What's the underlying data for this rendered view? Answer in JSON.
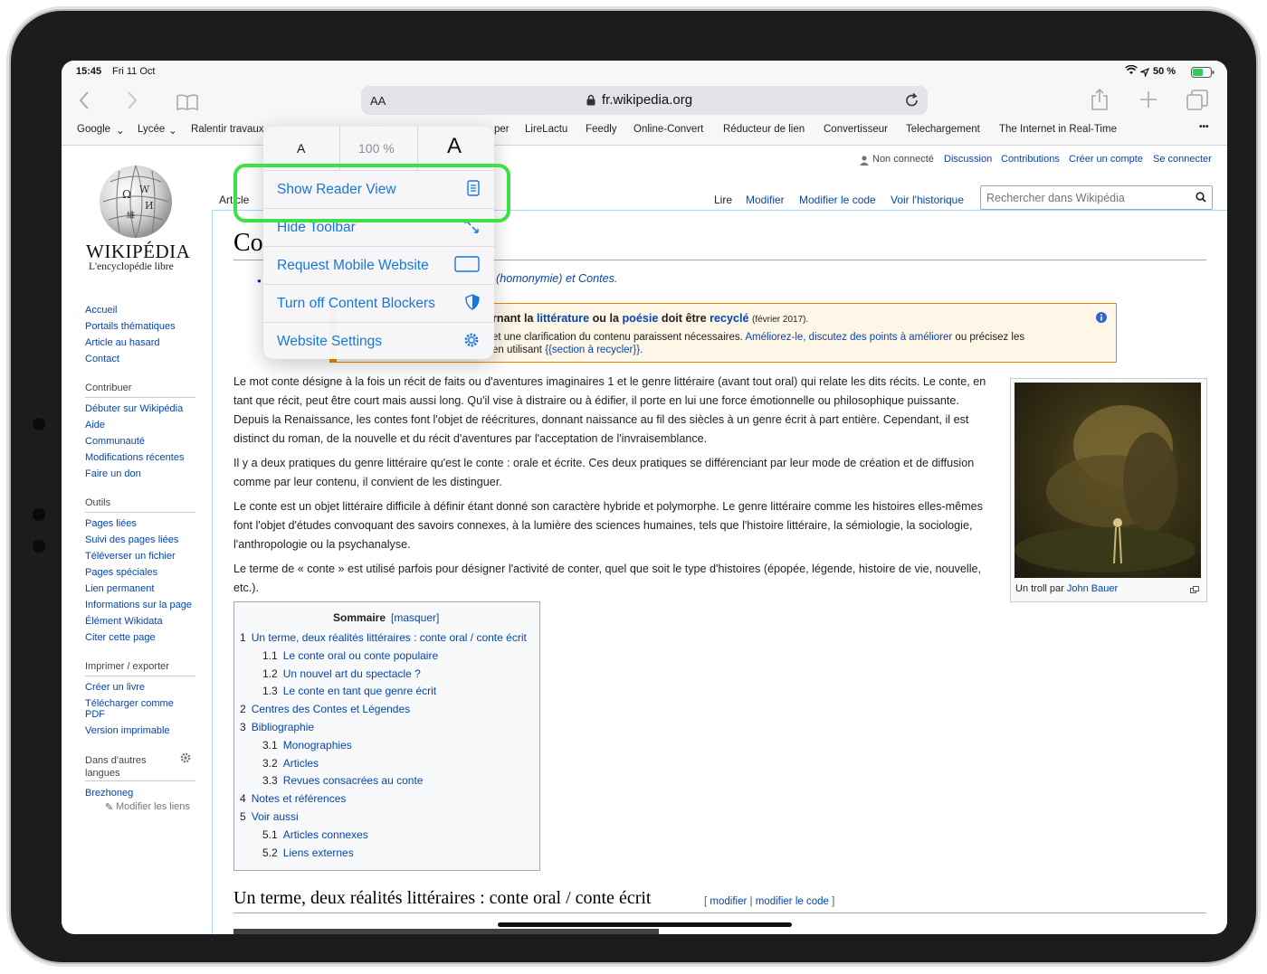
{
  "status": {
    "time": "15:45",
    "date": "Fri 11 Oct",
    "battery": "50 %"
  },
  "browser": {
    "url": "fr.wikipedia.org",
    "aa_label": "AA",
    "favorites": [
      "Google",
      "Lycée",
      "Ralentir travaux",
      "per",
      "LireLactu",
      "Feedly",
      "Online-Convert",
      "Réducteur de lien",
      "Convertisseur",
      "Telechargement",
      "The Internet in Real-Time"
    ],
    "more": "•••"
  },
  "menu": {
    "small_a": "A",
    "zoom": "100 %",
    "large_a": "A",
    "items": [
      "Show Reader View",
      "Hide Toolbar",
      "Request Mobile Website",
      "Turn off Content Blockers",
      "Website Settings"
    ]
  },
  "wiki": {
    "logo_title": "WIKIPÉDIA",
    "logo_subtitle": "L'encyclopédie libre",
    "user_links": [
      "Non connecté",
      "Discussion",
      "Contributions",
      "Créer un compte",
      "Se connecter"
    ],
    "tab_article": "Article",
    "view_tabs": [
      "Lire",
      "Modifier",
      "Modifier le code",
      "Voir l'historique"
    ],
    "search_placeholder": "Rechercher dans Wikipédia",
    "page_title_partial": "Co",
    "homonymie": "(homonymie) et Contes.",
    "banner_line1_a": "rnant la",
    "banner_line1_b": "littérature",
    "banner_line1_c": "ou la",
    "banner_line1_d": "poésie",
    "banner_line1_e": "doit être",
    "banner_line1_f": "recyclé",
    "banner_line1_g": "(février 2017).",
    "banner_line2_a": "et une clarification du contenu paraissent nécessaires.",
    "banner_line2_b": "Améliorez-le",
    "banner_line2_c": ", discutez des points à améliorer",
    "banner_line2_d": "ou précisez les",
    "banner_line3_a": "en utilisant",
    "banner_line3_b": "{{section à recycler}}.",
    "sidebar_nav": [
      "Accueil",
      "Portails thématiques",
      "Article au hasard",
      "Contact"
    ],
    "contrib_heading": "Contribuer",
    "contrib": [
      "Débuter sur Wikipédia",
      "Aide",
      "Communauté",
      "Modifications récentes",
      "Faire un don"
    ],
    "tools_heading": "Outils",
    "tools": [
      "Pages liées",
      "Suivi des pages liées",
      "Téléverser un fichier",
      "Pages spéciales",
      "Lien permanent",
      "Informations sur la page",
      "Élément Wikidata",
      "Citer cette page"
    ],
    "print_heading": "Imprimer / exporter",
    "print": [
      "Créer un livre",
      "Télécharger comme PDF",
      "Version imprimable"
    ],
    "lang_heading": "Dans d'autres langues",
    "lang": [
      "Brezhoneg"
    ],
    "edit_links": "Modifier les liens",
    "p1": "Le mot conte désigne à la fois un récit de faits ou d'aventures imaginaires 1 et le genre littéraire (avant tout oral) qui relate les dits récits. Le conte, en tant que récit, peut être court mais aussi long. Qu'il vise à distraire ou à édifier, il porte en lui une force émotionnelle ou philosophique puissante. Depuis la Renaissance, les contes font l'objet de réécritures, donnant naissance au fil des siècles à un genre écrit à part entière. Cependant, il est distinct du roman, de la nouvelle et du récit d'aventures par l'acceptation de l'invraisemblance.",
    "p2": "Il y a deux pratiques du genre littéraire qu'est le conte : orale et écrite. Ces deux pratiques se différenciant par leur mode de création et de diffusion comme par leur contenu, il convient de les distinguer.",
    "p3": "Le conte est un objet littéraire difficile à définir étant donné son caractère hybride et polymorphe. Le genre littéraire comme les histoires elles-mêmes font l'objet d'études convoquant des savoirs connexes, à la lumière des sciences humaines, tels que l'histoire littéraire, la sémiologie, la sociologie, l'anthropologie ou la psychanalyse.",
    "p4": "Le terme de « conte » est utilisé parfois pour désigner l'activité de conter, quel que soit le type d'histoires (épopée, légende, histoire de vie, nouvelle, etc.).",
    "caption_a": "Un troll par",
    "caption_b": "John Bauer",
    "toc_title": "Sommaire",
    "toc_hide": "[masquer]",
    "toc": [
      {
        "num": "1",
        "text": "Un terme, deux réalités littéraires : conte oral / conte écrit",
        "level": 1
      },
      {
        "num": "1.1",
        "text": "Le conte oral ou conte populaire",
        "level": 2
      },
      {
        "num": "1.2",
        "text": "Un nouvel art du spectacle ?",
        "level": 2
      },
      {
        "num": "1.3",
        "text": "Le conte en tant que genre écrit",
        "level": 2
      },
      {
        "num": "2",
        "text": "Centres des Contes et Légendes",
        "level": 1
      },
      {
        "num": "3",
        "text": "Bibliographie",
        "level": 1
      },
      {
        "num": "3.1",
        "text": "Monographies",
        "level": 2
      },
      {
        "num": "3.2",
        "text": "Articles",
        "level": 2
      },
      {
        "num": "3.3",
        "text": "Revues consacrées au conte",
        "level": 2
      },
      {
        "num": "4",
        "text": "Notes et références",
        "level": 1
      },
      {
        "num": "5",
        "text": "Voir aussi",
        "level": 1
      },
      {
        "num": "5.1",
        "text": "Articles connexes",
        "level": 2
      },
      {
        "num": "5.2",
        "text": "Liens externes",
        "level": 2
      }
    ],
    "h2": "Un terme, deux réalités littéraires : conte oral / conte écrit",
    "h2_edit": "modifier",
    "h2_edit_code": "modifier le code",
    "h2_edit_open": "[",
    "h2_edit_sep": "|",
    "h2_edit_close": "]"
  },
  "colors": {
    "highlight": "#3ee047",
    "menu_text": "#1877d8",
    "wiki_link": "#0645ad",
    "banner_border": "#f28500"
  }
}
